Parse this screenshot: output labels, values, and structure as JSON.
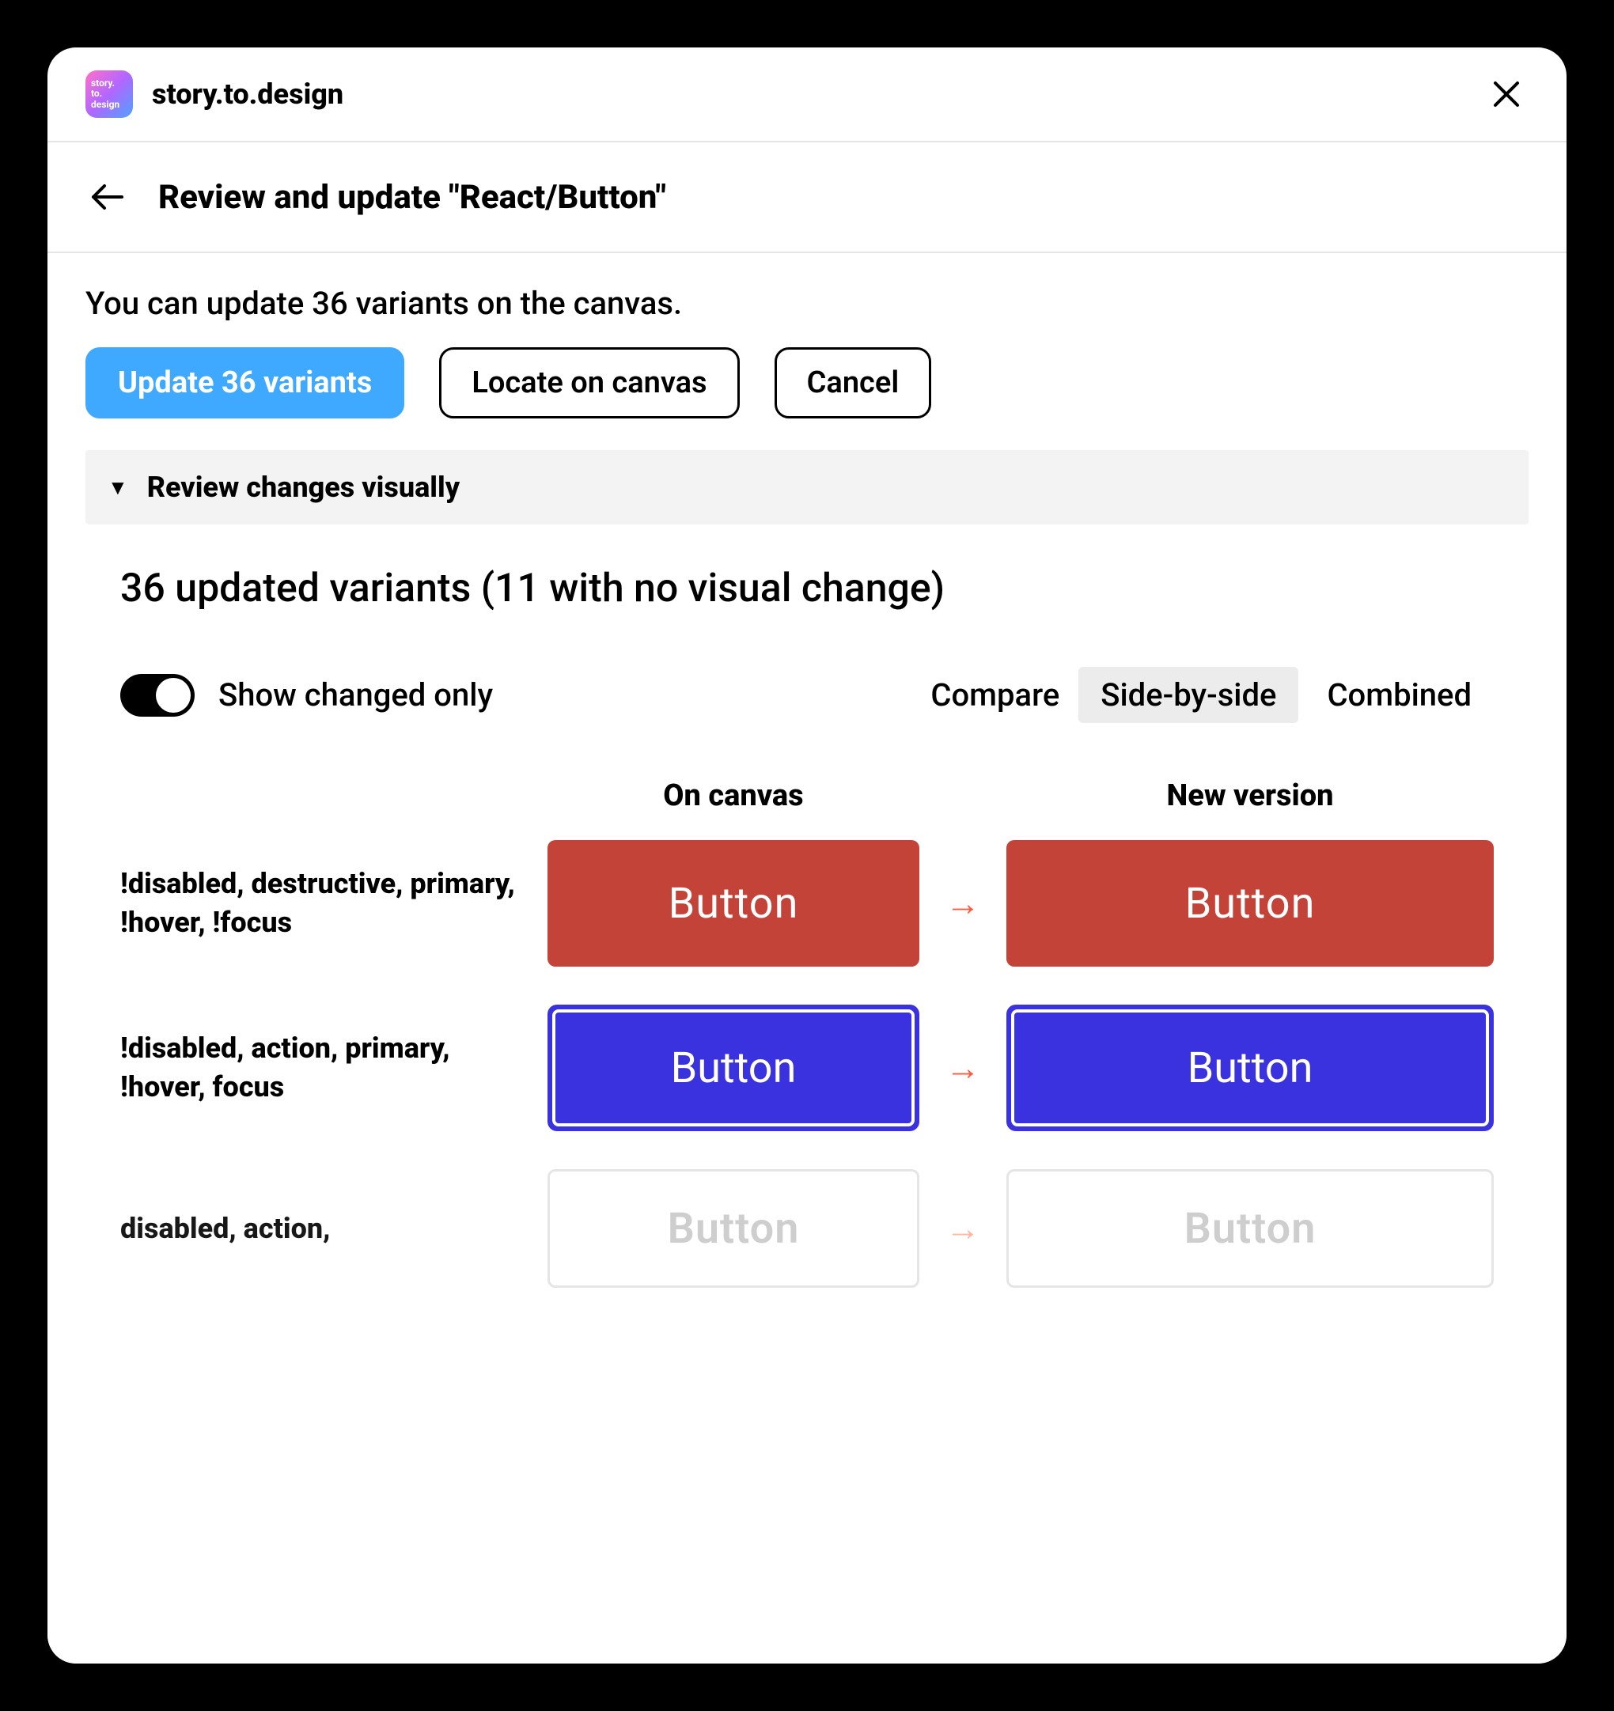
{
  "app": {
    "title": "story.to.design",
    "logo_lines": [
      "story.",
      "to.",
      "design"
    ]
  },
  "header": {
    "title": "Review and update \"React/Button\""
  },
  "hint": "You can update 36 variants on the canvas.",
  "actions": {
    "primary": "Update 36 variants",
    "locate": "Locate on canvas",
    "cancel": "Cancel"
  },
  "accordion": {
    "label": "Review changes visually",
    "expanded": true
  },
  "summary": "36 updated variants (11 with no visual change)",
  "toggle": {
    "label": "Show changed only",
    "on": true
  },
  "compare": {
    "label": "Compare",
    "options": [
      "Side-by-side",
      "Combined"
    ],
    "selected": "Side-by-side"
  },
  "columns": {
    "old": "On canvas",
    "new": "New version"
  },
  "rows": [
    {
      "label": "!disabled, destructive, primary, !hover, !focus",
      "style": "red",
      "text": "Button"
    },
    {
      "label": "!disabled, action, primary, !hover, focus",
      "style": "blue",
      "text": "Button"
    },
    {
      "label": "disabled, action,",
      "style": "disabled",
      "text": "Button"
    }
  ]
}
